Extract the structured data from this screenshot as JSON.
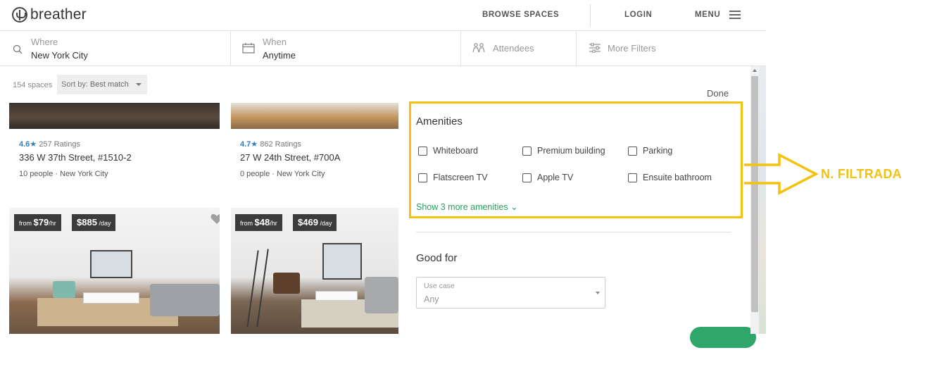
{
  "header": {
    "brand": "breather",
    "nav": {
      "browse": "BROWSE SPACES",
      "login": "LOGIN",
      "menu": "MENU"
    }
  },
  "search": {
    "where_label": "Where",
    "where_value": "New York City",
    "when_label": "When",
    "when_value": "Anytime",
    "attendees": "Attendees",
    "more_filters": "More Filters"
  },
  "listing": {
    "count": "154 spaces",
    "sort_label": "Sort by:",
    "sort_value": "Best match",
    "cards": [
      {
        "score": "4.6",
        "ratings": "257 Ratings",
        "address": "336 W 37th Street, #1510-2",
        "people": "10 people",
        "city": "New York City"
      },
      {
        "score": "4.7",
        "ratings": "862 Ratings",
        "address": "27 W 24th Street, #700A",
        "people": "0 people",
        "city": "New York City"
      }
    ],
    "prices": [
      {
        "hourly_from": "from",
        "hourly": "$79",
        "hourly_unit": "/hr",
        "daily": "$885",
        "daily_unit": "/day"
      },
      {
        "hourly_from": "from",
        "hourly": "$48",
        "hourly_unit": "/hr",
        "daily": "$469",
        "daily_unit": "/day"
      }
    ]
  },
  "filters": {
    "done": "Done",
    "amenities_title": "Amenities",
    "amenities": [
      {
        "label": "Whiteboard",
        "checked": false
      },
      {
        "label": "Premium building",
        "checked": false
      },
      {
        "label": "Parking",
        "checked": false
      },
      {
        "label": "Flatscreen TV",
        "checked": false
      },
      {
        "label": "Apple TV",
        "checked": false
      },
      {
        "label": "Ensuite bathroom",
        "checked": false
      }
    ],
    "show_more": "Show 3 more amenities",
    "good_for_title": "Good for",
    "use_case_label": "Use case",
    "use_case_value": "Any"
  },
  "annotation": {
    "label": "N. FILTRADA",
    "color": "#f4c20d"
  },
  "colors": {
    "accent_green": "#2fa66a",
    "rating_blue": "#2f7fc1"
  }
}
